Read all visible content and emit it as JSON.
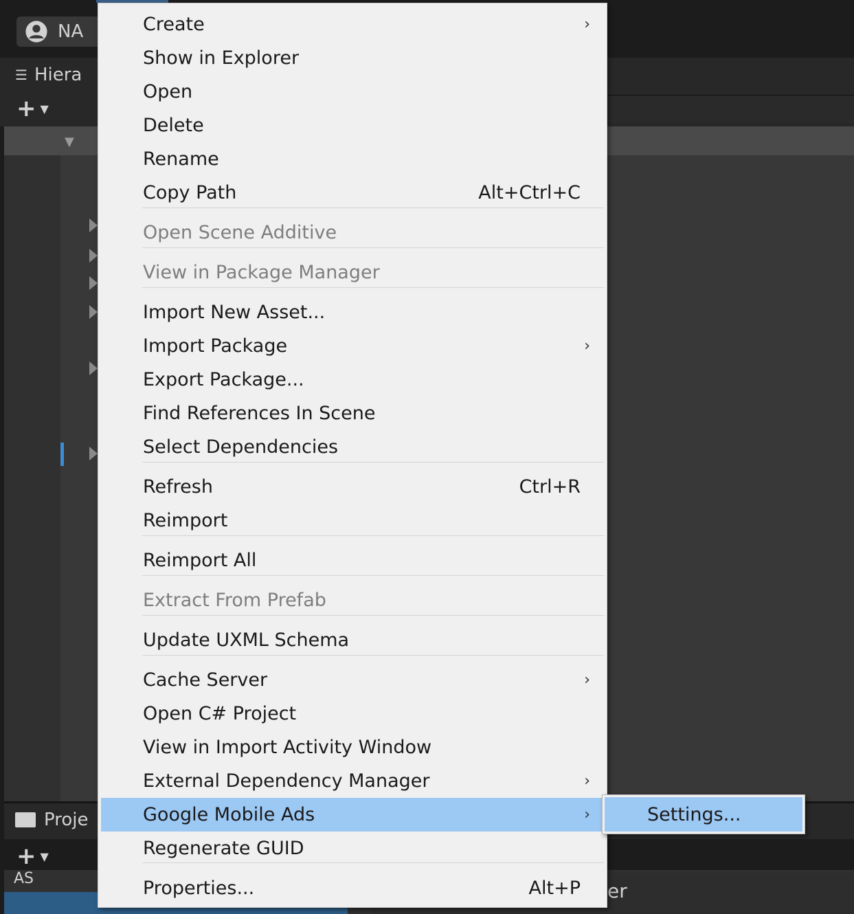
{
  "toolbar": {
    "account_label": "NA"
  },
  "hierarchy": {
    "title": "Hiera"
  },
  "project": {
    "title": "Proje",
    "assets_label": "AS",
    "right_text": "er"
  },
  "colors": {
    "menu_bg": "#f0f0f0",
    "highlight": "#9cc8f4",
    "disabled_text": "#7e7e7e",
    "editor_bg": "#383838",
    "selection_blue": "#3d8cd6"
  },
  "icons": {
    "account": "account-circle-icon",
    "hierarchy": "list-icon",
    "project": "folder-icon",
    "add": "plus-icon",
    "submenu": "chevron-right-icon"
  },
  "context_menu": {
    "items": [
      {
        "label": "Create",
        "submenu": true
      },
      {
        "label": "Show in Explorer"
      },
      {
        "label": "Open"
      },
      {
        "label": "Delete"
      },
      {
        "label": "Rename"
      },
      {
        "label": "Copy Path",
        "shortcut": "Alt+Ctrl+C"
      },
      {
        "label": "Open Scene Additive",
        "disabled": true
      },
      {
        "label": "View in Package Manager",
        "disabled": true
      },
      {
        "label": "Import New Asset..."
      },
      {
        "label": "Import Package",
        "submenu": true
      },
      {
        "label": "Export Package..."
      },
      {
        "label": "Find References In Scene"
      },
      {
        "label": "Select Dependencies"
      },
      {
        "label": "Refresh",
        "shortcut": "Ctrl+R"
      },
      {
        "label": "Reimport"
      },
      {
        "label": "Reimport All"
      },
      {
        "label": "Extract From Prefab",
        "disabled": true
      },
      {
        "label": "Update UXML Schema"
      },
      {
        "label": "Cache Server",
        "submenu": true
      },
      {
        "label": "Open C# Project"
      },
      {
        "label": "View in Import Activity Window"
      },
      {
        "label": "External Dependency Manager",
        "submenu": true
      },
      {
        "label": "Google Mobile Ads",
        "submenu": true,
        "highlighted": true
      },
      {
        "label": "Regenerate GUID"
      },
      {
        "label": "Properties...",
        "shortcut": "Alt+P"
      }
    ]
  },
  "submenu": {
    "items": [
      {
        "label": "Settings...",
        "highlighted": true
      }
    ]
  }
}
